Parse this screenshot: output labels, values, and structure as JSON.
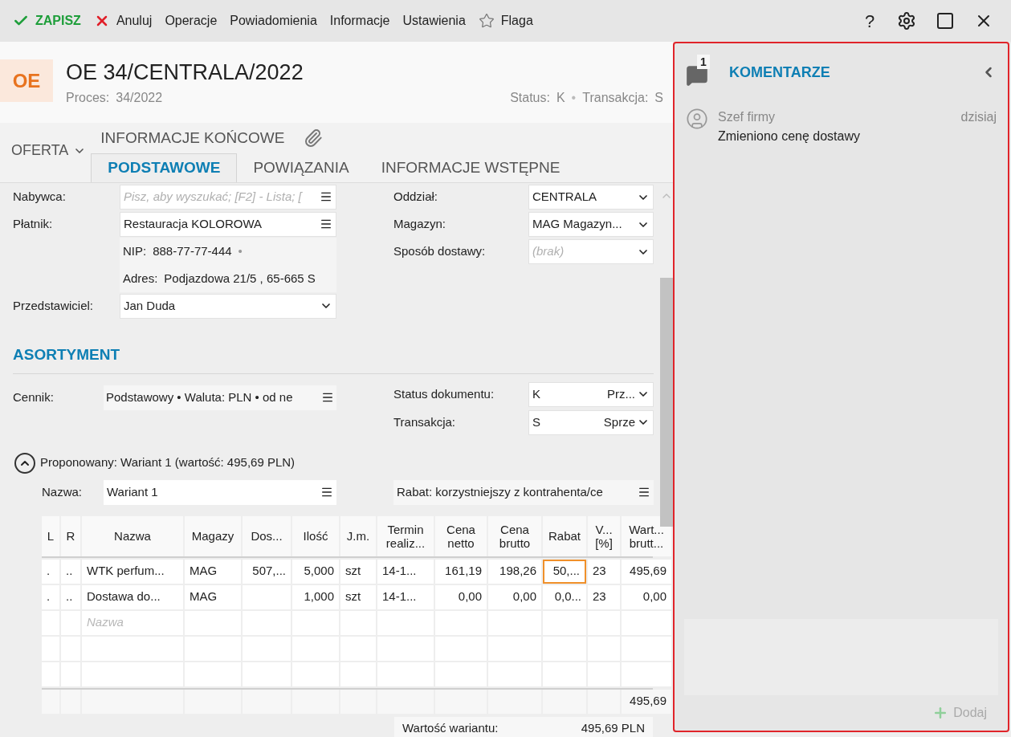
{
  "toolbar": {
    "items": [
      {
        "label": "ZAPISZ",
        "kind": "save"
      },
      {
        "label": "Anuluj",
        "kind": "cancel"
      },
      {
        "label": "Operacje",
        "kind": "menu"
      },
      {
        "label": "Powiadomienia",
        "kind": "menu"
      },
      {
        "label": "Informacje",
        "kind": "menu"
      },
      {
        "label": "Ustawienia",
        "kind": "menu"
      },
      {
        "label": "Flaga",
        "kind": "flag"
      }
    ],
    "help_label": "?"
  },
  "document": {
    "badge": "OE",
    "title": "OE 34/CENTRALA/2022",
    "process_label": "Proces:",
    "process_value": "34/2022",
    "meta": [
      {
        "label": "Status:",
        "value": "K"
      },
      {
        "label": "Transakcja:",
        "value": "S"
      }
    ],
    "meta_separator": "•"
  },
  "tabs": {
    "menu_label": "OFERTA",
    "upper": [
      {
        "label": "INFORMACJE KOŃCOWE",
        "selected": false
      }
    ],
    "lower": [
      {
        "label": "PODSTAWOWE",
        "selected": true
      },
      {
        "label": "POWIĄZANIA",
        "selected": false
      },
      {
        "label": "INFORMACJE WSTĘPNE",
        "selected": false
      }
    ]
  },
  "party_fields": [
    {
      "kind": "lookup",
      "label": "Nabywca:",
      "placeholder": "Pisz, aby wyszukać; [F2] - Lista; ["
    },
    {
      "kind": "lookup",
      "label": "Płatnik:",
      "value": "Restauracja KOLOROWA"
    },
    {
      "kind": "info",
      "label": "NIP:",
      "value": "888-77-77-444",
      "suffix": "•"
    },
    {
      "kind": "info",
      "label": "Adres:",
      "value": "Podjazdowa  21/5 , 65-665 S"
    },
    {
      "kind": "dropdown",
      "label": "Przedstawiciel:",
      "value": "Jan Duda"
    }
  ],
  "branch_fields": [
    {
      "kind": "dropdown",
      "label": "Oddział:",
      "value": "CENTRALA"
    },
    {
      "kind": "dropdown",
      "label": "Magazyn:",
      "value": "MAG  Magazyn..."
    },
    {
      "kind": "dropdown",
      "label": "Sposób dostawy:",
      "placeholder": "(brak)"
    }
  ],
  "assortment": {
    "heading": "ASORTYMENT",
    "pricelist_label": "Cennik:",
    "pricelist_value": "Podstawowy • Waluta: PLN • od ne",
    "status_fields": [
      {
        "label": "Status dokumentu:",
        "code": "K",
        "value": "Prz..."
      },
      {
        "label": "Transakcja:",
        "code": "S",
        "value": "Sprze"
      }
    ]
  },
  "variant": {
    "expanded": true,
    "summary": "Proponowany: Wariant 1 (wartość: 495,69 PLN)",
    "name_label": "Nazwa:",
    "name_value": "Wariant 1",
    "discount": "Rabat: korzystniejszy z kontrahenta/ce"
  },
  "table": {
    "columns": [
      {
        "lines": [
          "L"
        ]
      },
      {
        "lines": [
          "R"
        ]
      },
      {
        "lines": [
          "Nazwa"
        ]
      },
      {
        "lines": [
          "Magazy"
        ]
      },
      {
        "lines": [
          "Dos..."
        ]
      },
      {
        "lines": [
          "Ilość"
        ]
      },
      {
        "lines": [
          "J.m."
        ]
      },
      {
        "lines": [
          "Termin",
          "realiz..."
        ]
      },
      {
        "lines": [
          "Cena",
          "netto"
        ]
      },
      {
        "lines": [
          "Cena",
          "brutto"
        ]
      },
      {
        "lines": [
          "Rabat"
        ]
      },
      {
        "lines": [
          "V...",
          "[%]"
        ]
      },
      {
        "lines": [
          "Wart...",
          "brutt..."
        ]
      }
    ],
    "rows": [
      {
        "kind": "item",
        "cells": [
          {
            "text": ".",
            "focused": false
          },
          {
            "text": "..",
            "focused": false
          },
          {
            "text": "WTK perfum...",
            "focused": false
          },
          {
            "text": "MAG",
            "focused": false
          },
          {
            "text": "507,...",
            "focused": false
          },
          {
            "text": "5,000",
            "focused": false
          },
          {
            "text": "szt",
            "focused": false
          },
          {
            "text": "14-1...",
            "focused": false
          },
          {
            "text": "161,19",
            "focused": false
          },
          {
            "text": "198,26",
            "focused": false
          },
          {
            "text": "50,...",
            "focused": true
          },
          {
            "text": "23",
            "focused": false
          },
          {
            "text": "495,69",
            "focused": false
          }
        ]
      },
      {
        "kind": "item",
        "cells": [
          {
            "text": ".",
            "focused": false
          },
          {
            "text": "..",
            "focused": false
          },
          {
            "text": "Dostawa do...",
            "focused": false
          },
          {
            "text": "MAG",
            "focused": false
          },
          {
            "focused": false
          },
          {
            "text": "1,000",
            "focused": false
          },
          {
            "text": "szt",
            "focused": false
          },
          {
            "text": "14-1...",
            "focused": false
          },
          {
            "text": "0,00",
            "focused": false
          },
          {
            "text": "0,00",
            "focused": false
          },
          {
            "text": "0,0...",
            "focused": false
          },
          {
            "text": "23",
            "focused": false
          },
          {
            "text": "0,00",
            "focused": false
          }
        ]
      },
      {
        "kind": "new",
        "placeholder": "Nazwa"
      },
      {
        "kind": "empty"
      },
      {
        "kind": "empty"
      }
    ],
    "total": "495,69"
  },
  "variant_value": {
    "label": "Wartość wariantu:",
    "value": "495,69 PLN"
  },
  "comments": {
    "count": "1",
    "title": "KOMENTARZE",
    "items": [
      {
        "author": "Szef firmy",
        "date": "dzisiaj",
        "text": "Zmieniono cenę dostawy"
      }
    ],
    "add_label": "Dodaj"
  }
}
